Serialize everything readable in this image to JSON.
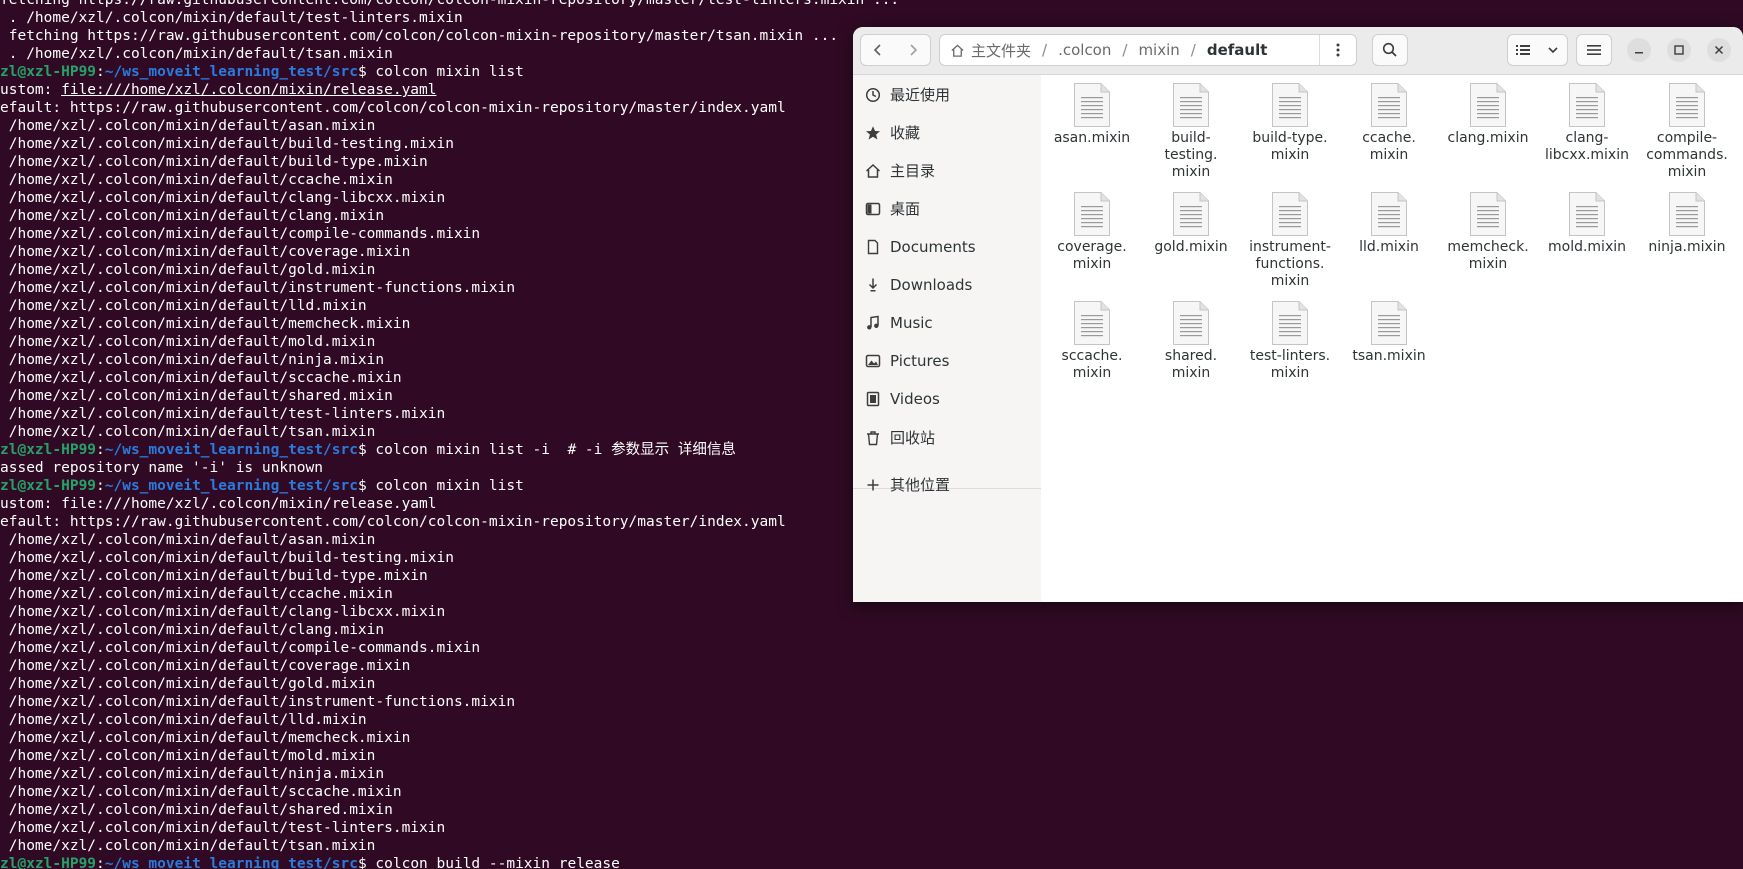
{
  "terminal": {
    "prompt_user": "zl@xzl-HP99",
    "prompt_path": "~/ws_moveit_learning_test/src",
    "lines": [
      {
        "t": "fetching https://raw.githubusercontent.com/colcon/colcon-mixin-repository/master/test-linters.mixin ..."
      },
      {
        "t": " . /home/xzl/.colcon/mixin/default/test-linters.mixin"
      },
      {
        "t": " fetching https://raw.githubusercontent.com/colcon/colcon-mixin-repository/master/tsan.mixin ..."
      },
      {
        "t": " . /home/xzl/.colcon/mixin/default/tsan.mixin"
      },
      {
        "cmd": "colcon mixin list"
      },
      {
        "pre": "ustom: ",
        "link": "file:///home/xzl/.colcon/mixin/release.yaml"
      },
      {
        "t": "efault: https://raw.githubusercontent.com/colcon/colcon-mixin-repository/master/index.yaml"
      },
      {
        "t": " /home/xzl/.colcon/mixin/default/asan.mixin"
      },
      {
        "t": " /home/xzl/.colcon/mixin/default/build-testing.mixin"
      },
      {
        "t": " /home/xzl/.colcon/mixin/default/build-type.mixin"
      },
      {
        "t": " /home/xzl/.colcon/mixin/default/ccache.mixin"
      },
      {
        "t": " /home/xzl/.colcon/mixin/default/clang-libcxx.mixin"
      },
      {
        "t": " /home/xzl/.colcon/mixin/default/clang.mixin"
      },
      {
        "t": " /home/xzl/.colcon/mixin/default/compile-commands.mixin"
      },
      {
        "t": " /home/xzl/.colcon/mixin/default/coverage.mixin"
      },
      {
        "t": " /home/xzl/.colcon/mixin/default/gold.mixin"
      },
      {
        "t": " /home/xzl/.colcon/mixin/default/instrument-functions.mixin"
      },
      {
        "t": " /home/xzl/.colcon/mixin/default/lld.mixin"
      },
      {
        "t": " /home/xzl/.colcon/mixin/default/memcheck.mixin"
      },
      {
        "t": " /home/xzl/.colcon/mixin/default/mold.mixin"
      },
      {
        "t": " /home/xzl/.colcon/mixin/default/ninja.mixin"
      },
      {
        "t": " /home/xzl/.colcon/mixin/default/sccache.mixin"
      },
      {
        "t": " /home/xzl/.colcon/mixin/default/shared.mixin"
      },
      {
        "t": " /home/xzl/.colcon/mixin/default/test-linters.mixin"
      },
      {
        "t": " /home/xzl/.colcon/mixin/default/tsan.mixin"
      },
      {
        "cmd": "colcon mixin list -i  # -i 参数显示 详细信息"
      },
      {
        "t": "assed repository name '-i' is unknown"
      },
      {
        "cmd": "colcon mixin list"
      },
      {
        "t": "ustom: file:///home/xzl/.colcon/mixin/release.yaml"
      },
      {
        "t": "efault: https://raw.githubusercontent.com/colcon/colcon-mixin-repository/master/index.yaml"
      },
      {
        "t": " /home/xzl/.colcon/mixin/default/asan.mixin"
      },
      {
        "t": " /home/xzl/.colcon/mixin/default/build-testing.mixin"
      },
      {
        "t": " /home/xzl/.colcon/mixin/default/build-type.mixin"
      },
      {
        "t": " /home/xzl/.colcon/mixin/default/ccache.mixin"
      },
      {
        "t": " /home/xzl/.colcon/mixin/default/clang-libcxx.mixin"
      },
      {
        "t": " /home/xzl/.colcon/mixin/default/clang.mixin"
      },
      {
        "t": " /home/xzl/.colcon/mixin/default/compile-commands.mixin"
      },
      {
        "t": " /home/xzl/.colcon/mixin/default/coverage.mixin"
      },
      {
        "t": " /home/xzl/.colcon/mixin/default/gold.mixin"
      },
      {
        "t": " /home/xzl/.colcon/mixin/default/instrument-functions.mixin"
      },
      {
        "t": " /home/xzl/.colcon/mixin/default/lld.mixin"
      },
      {
        "t": " /home/xzl/.colcon/mixin/default/memcheck.mixin"
      },
      {
        "t": " /home/xzl/.colcon/mixin/default/mold.mixin"
      },
      {
        "t": " /home/xzl/.colcon/mixin/default/ninja.mixin"
      },
      {
        "t": " /home/xzl/.colcon/mixin/default/sccache.mixin"
      },
      {
        "t": " /home/xzl/.colcon/mixin/default/shared.mixin"
      },
      {
        "t": " /home/xzl/.colcon/mixin/default/test-linters.mixin"
      },
      {
        "t": " /home/xzl/.colcon/mixin/default/tsan.mixin"
      },
      {
        "cmd": "colcon build --mixin release"
      }
    ]
  },
  "files": {
    "path": {
      "home": "主文件夹",
      "seg1": ".colcon",
      "seg2": "mixin",
      "current": "default",
      "separator": "/"
    },
    "icons": {
      "back": "chevron-left-icon",
      "forward": "chevron-right-icon",
      "home": "home-icon",
      "path_menu": "vertical-dots-icon",
      "search": "search-icon",
      "list_view": "list-view-icon",
      "view_options": "chevron-down-icon",
      "main_menu": "hamburger-menu-icon",
      "minimize": "minimize-icon",
      "maximize": "maximize-icon",
      "close": "close-icon",
      "file": "text-file-icon"
    },
    "sidebar": {
      "recent": "最近使用",
      "starred": "收藏",
      "home": "主目录",
      "desktop": "桌面",
      "documents": "Documents",
      "downloads": "Downloads",
      "music": "Music",
      "pictures": "Pictures",
      "videos": "Videos",
      "trash": "回收站",
      "other": "其他位置"
    },
    "items": [
      {
        "name": "asan.mixin"
      },
      {
        "name": "build-\ntesting.\nmixin"
      },
      {
        "name": "build-type.\nmixin"
      },
      {
        "name": "ccache.\nmixin"
      },
      {
        "name": "clang.mixin"
      },
      {
        "name": "clang-\nlibcxx.mixin"
      },
      {
        "name": "compile-\ncommands.\nmixin"
      },
      {
        "name": "coverage.\nmixin"
      },
      {
        "name": "gold.mixin"
      },
      {
        "name": "instrument-\nfunctions.\nmixin"
      },
      {
        "name": "lld.mixin"
      },
      {
        "name": "memcheck.\nmixin"
      },
      {
        "name": "mold.mixin"
      },
      {
        "name": "ninja.mixin"
      },
      {
        "name": "sccache.\nmixin"
      },
      {
        "name": "shared.\nmixin"
      },
      {
        "name": "test-linters.\nmixin"
      },
      {
        "name": "tsan.mixin"
      }
    ]
  },
  "colors": {
    "terminal_bg": "#300a24",
    "prompt_user": "#26a269",
    "prompt_path": "#2a7bde",
    "window_bg": "#ffffff",
    "sidebar_bg": "#f6f5f4"
  }
}
